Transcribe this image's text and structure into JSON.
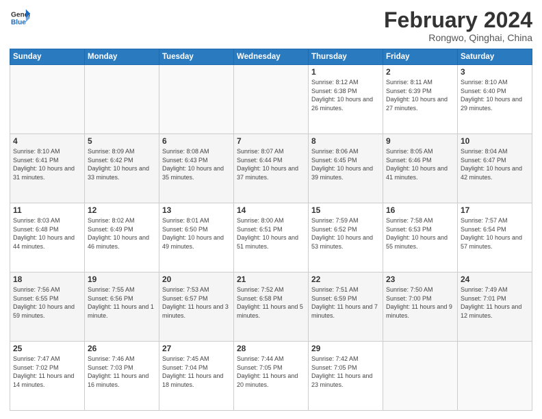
{
  "logo": {
    "text_general": "General",
    "text_blue": "Blue"
  },
  "header": {
    "month_year": "February 2024",
    "location": "Rongwo, Qinghai, China"
  },
  "weekdays": [
    "Sunday",
    "Monday",
    "Tuesday",
    "Wednesday",
    "Thursday",
    "Friday",
    "Saturday"
  ],
  "weeks": [
    [
      {
        "day": "",
        "info": ""
      },
      {
        "day": "",
        "info": ""
      },
      {
        "day": "",
        "info": ""
      },
      {
        "day": "",
        "info": ""
      },
      {
        "day": "1",
        "info": "Sunrise: 8:12 AM\nSunset: 6:38 PM\nDaylight: 10 hours\nand 26 minutes."
      },
      {
        "day": "2",
        "info": "Sunrise: 8:11 AM\nSunset: 6:39 PM\nDaylight: 10 hours\nand 27 minutes."
      },
      {
        "day": "3",
        "info": "Sunrise: 8:10 AM\nSunset: 6:40 PM\nDaylight: 10 hours\nand 29 minutes."
      }
    ],
    [
      {
        "day": "4",
        "info": "Sunrise: 8:10 AM\nSunset: 6:41 PM\nDaylight: 10 hours\nand 31 minutes."
      },
      {
        "day": "5",
        "info": "Sunrise: 8:09 AM\nSunset: 6:42 PM\nDaylight: 10 hours\nand 33 minutes."
      },
      {
        "day": "6",
        "info": "Sunrise: 8:08 AM\nSunset: 6:43 PM\nDaylight: 10 hours\nand 35 minutes."
      },
      {
        "day": "7",
        "info": "Sunrise: 8:07 AM\nSunset: 6:44 PM\nDaylight: 10 hours\nand 37 minutes."
      },
      {
        "day": "8",
        "info": "Sunrise: 8:06 AM\nSunset: 6:45 PM\nDaylight: 10 hours\nand 39 minutes."
      },
      {
        "day": "9",
        "info": "Sunrise: 8:05 AM\nSunset: 6:46 PM\nDaylight: 10 hours\nand 41 minutes."
      },
      {
        "day": "10",
        "info": "Sunrise: 8:04 AM\nSunset: 6:47 PM\nDaylight: 10 hours\nand 42 minutes."
      }
    ],
    [
      {
        "day": "11",
        "info": "Sunrise: 8:03 AM\nSunset: 6:48 PM\nDaylight: 10 hours\nand 44 minutes."
      },
      {
        "day": "12",
        "info": "Sunrise: 8:02 AM\nSunset: 6:49 PM\nDaylight: 10 hours\nand 46 minutes."
      },
      {
        "day": "13",
        "info": "Sunrise: 8:01 AM\nSunset: 6:50 PM\nDaylight: 10 hours\nand 49 minutes."
      },
      {
        "day": "14",
        "info": "Sunrise: 8:00 AM\nSunset: 6:51 PM\nDaylight: 10 hours\nand 51 minutes."
      },
      {
        "day": "15",
        "info": "Sunrise: 7:59 AM\nSunset: 6:52 PM\nDaylight: 10 hours\nand 53 minutes."
      },
      {
        "day": "16",
        "info": "Sunrise: 7:58 AM\nSunset: 6:53 PM\nDaylight: 10 hours\nand 55 minutes."
      },
      {
        "day": "17",
        "info": "Sunrise: 7:57 AM\nSunset: 6:54 PM\nDaylight: 10 hours\nand 57 minutes."
      }
    ],
    [
      {
        "day": "18",
        "info": "Sunrise: 7:56 AM\nSunset: 6:55 PM\nDaylight: 10 hours\nand 59 minutes."
      },
      {
        "day": "19",
        "info": "Sunrise: 7:55 AM\nSunset: 6:56 PM\nDaylight: 11 hours\nand 1 minute."
      },
      {
        "day": "20",
        "info": "Sunrise: 7:53 AM\nSunset: 6:57 PM\nDaylight: 11 hours\nand 3 minutes."
      },
      {
        "day": "21",
        "info": "Sunrise: 7:52 AM\nSunset: 6:58 PM\nDaylight: 11 hours\nand 5 minutes."
      },
      {
        "day": "22",
        "info": "Sunrise: 7:51 AM\nSunset: 6:59 PM\nDaylight: 11 hours\nand 7 minutes."
      },
      {
        "day": "23",
        "info": "Sunrise: 7:50 AM\nSunset: 7:00 PM\nDaylight: 11 hours\nand 9 minutes."
      },
      {
        "day": "24",
        "info": "Sunrise: 7:49 AM\nSunset: 7:01 PM\nDaylight: 11 hours\nand 12 minutes."
      }
    ],
    [
      {
        "day": "25",
        "info": "Sunrise: 7:47 AM\nSunset: 7:02 PM\nDaylight: 11 hours\nand 14 minutes."
      },
      {
        "day": "26",
        "info": "Sunrise: 7:46 AM\nSunset: 7:03 PM\nDaylight: 11 hours\nand 16 minutes."
      },
      {
        "day": "27",
        "info": "Sunrise: 7:45 AM\nSunset: 7:04 PM\nDaylight: 11 hours\nand 18 minutes."
      },
      {
        "day": "28",
        "info": "Sunrise: 7:44 AM\nSunset: 7:05 PM\nDaylight: 11 hours\nand 20 minutes."
      },
      {
        "day": "29",
        "info": "Sunrise: 7:42 AM\nSunset: 7:05 PM\nDaylight: 11 hours\nand 23 minutes."
      },
      {
        "day": "",
        "info": ""
      },
      {
        "day": "",
        "info": ""
      }
    ]
  ]
}
